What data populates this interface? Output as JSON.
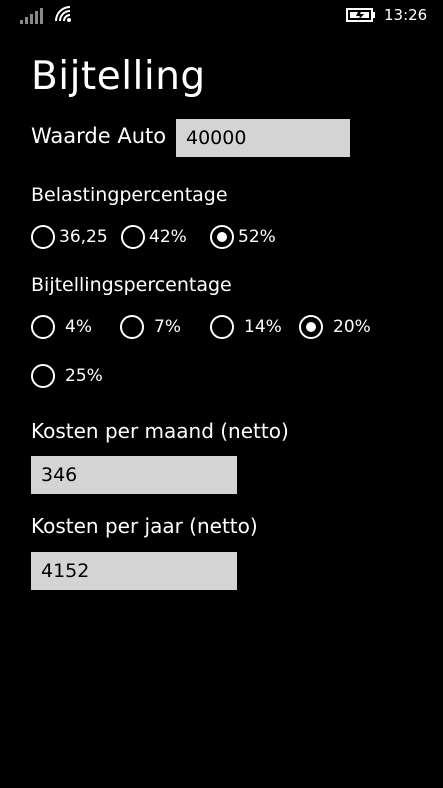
{
  "status_bar": {
    "time": "13:26",
    "signal_icon": "signal-strength-icon",
    "wifi_icon": "wifi-icon",
    "battery_icon": "battery-charging-icon"
  },
  "page": {
    "title": "Bijtelling"
  },
  "waarde_auto": {
    "label": "Waarde Auto",
    "value": "40000"
  },
  "belasting": {
    "label": "Belastingpercentage",
    "options": [
      {
        "label": "36,25",
        "checked": false
      },
      {
        "label": "42%",
        "checked": false
      },
      {
        "label": "52%",
        "checked": true
      }
    ]
  },
  "bijtelling": {
    "label": "Bijtellingspercentage",
    "options": [
      {
        "label": "4%",
        "checked": false
      },
      {
        "label": "7%",
        "checked": false
      },
      {
        "label": "14%",
        "checked": false
      },
      {
        "label": "20%",
        "checked": true
      },
      {
        "label": "25%",
        "checked": false
      }
    ]
  },
  "kosten_maand": {
    "label": "Kosten per maand (netto)",
    "value": "346"
  },
  "kosten_jaar": {
    "label": "Kosten per jaar (netto)",
    "value": "4152"
  }
}
